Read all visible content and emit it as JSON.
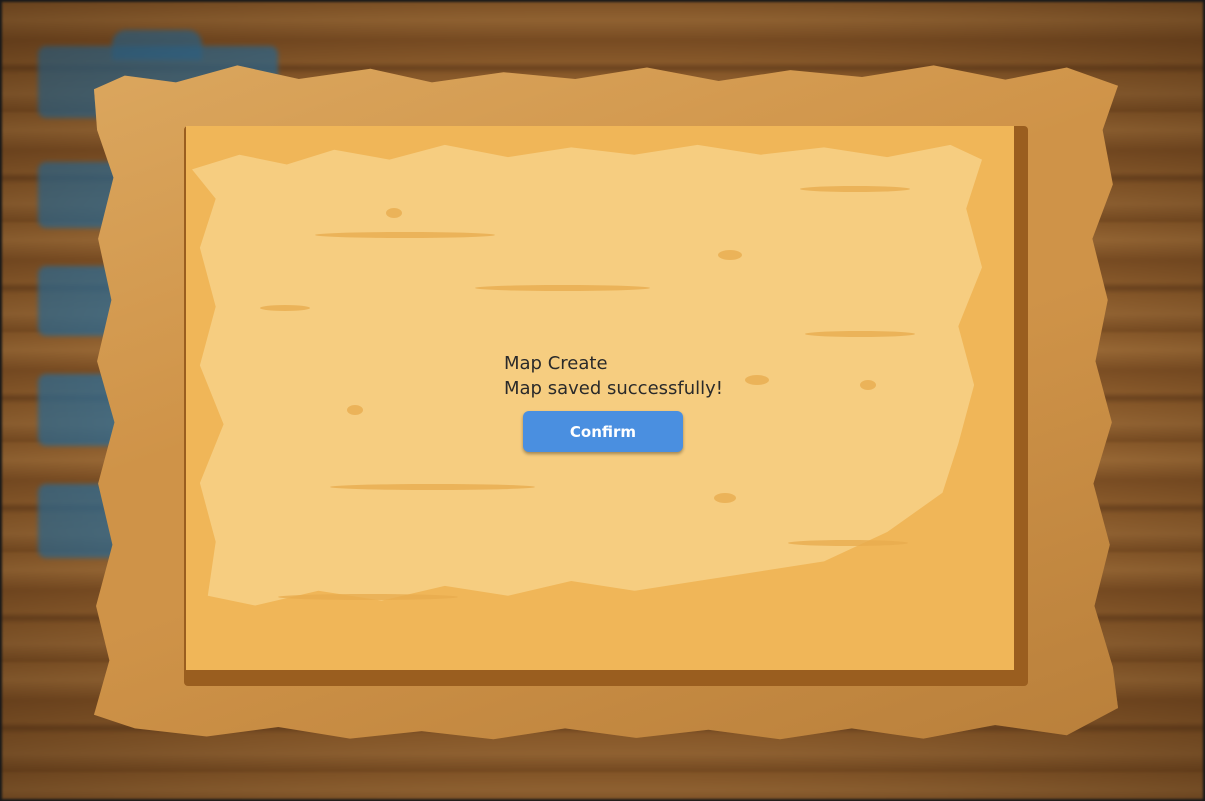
{
  "dialog": {
    "title": "Map Create",
    "message": "Map saved successfully!",
    "confirm_label": "Confirm"
  },
  "colors": {
    "button": "#4a8fe0",
    "parchment": "#f6cd80",
    "frame": "#cf9348",
    "wood": "#8a5a2a"
  }
}
